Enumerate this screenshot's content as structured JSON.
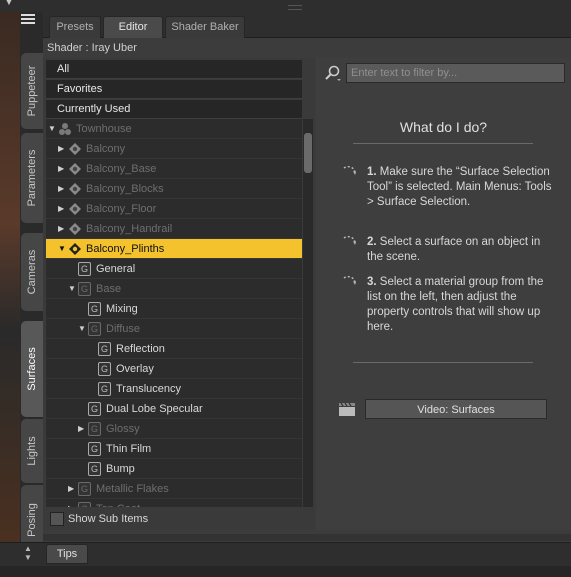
{
  "vertical_tabs": [
    "Puppeteer",
    "Parameters",
    "Cameras",
    "Surfaces",
    "Lights",
    "Posing"
  ],
  "active_vertical_tab": "Surfaces",
  "tabs": [
    "Presets",
    "Editor",
    "Shader Baker"
  ],
  "active_tab": "Editor",
  "shader_label": "Shader : Iray Uber",
  "filters": [
    "All",
    "Favorites",
    "Currently Used"
  ],
  "tree": [
    {
      "label": "Townhouse",
      "indent": 0,
      "expand": "down",
      "icon": "figure",
      "dim": true
    },
    {
      "label": "Balcony",
      "indent": 1,
      "expand": "right",
      "icon": "object",
      "dim": true
    },
    {
      "label": "Balcony_Base",
      "indent": 1,
      "expand": "right",
      "icon": "object",
      "dim": true
    },
    {
      "label": "Balcony_Blocks",
      "indent": 1,
      "expand": "right",
      "icon": "object",
      "dim": true
    },
    {
      "label": "Balcony_Floor",
      "indent": 1,
      "expand": "right",
      "icon": "object",
      "dim": true
    },
    {
      "label": "Balcony_Handrail",
      "indent": 1,
      "expand": "right",
      "icon": "object",
      "dim": true
    },
    {
      "label": "Balcony_Plinths",
      "indent": 1,
      "expand": "down",
      "icon": "object",
      "dim": false,
      "selected": true
    },
    {
      "label": "General",
      "indent": 2,
      "expand": "",
      "icon": "group",
      "dim": false
    },
    {
      "label": "Base",
      "indent": 2,
      "expand": "down",
      "icon": "group",
      "dim": true
    },
    {
      "label": "Mixing",
      "indent": 3,
      "expand": "",
      "icon": "group",
      "dim": false
    },
    {
      "label": "Diffuse",
      "indent": 3,
      "expand": "down",
      "icon": "group",
      "dim": true
    },
    {
      "label": "Reflection",
      "indent": 4,
      "expand": "",
      "icon": "group",
      "dim": false
    },
    {
      "label": "Overlay",
      "indent": 4,
      "expand": "",
      "icon": "group",
      "dim": false
    },
    {
      "label": "Translucency",
      "indent": 4,
      "expand": "",
      "icon": "group",
      "dim": false
    },
    {
      "label": "Dual Lobe Specular",
      "indent": 3,
      "expand": "",
      "icon": "group",
      "dim": false
    },
    {
      "label": "Glossy",
      "indent": 3,
      "expand": "right",
      "icon": "group",
      "dim": true
    },
    {
      "label": "Thin Film",
      "indent": 3,
      "expand": "",
      "icon": "group",
      "dim": false
    },
    {
      "label": "Bump",
      "indent": 3,
      "expand": "",
      "icon": "group",
      "dim": false
    },
    {
      "label": "Metallic Flakes",
      "indent": 2,
      "expand": "right",
      "icon": "group",
      "dim": true
    },
    {
      "label": "Top Coat",
      "indent": 2,
      "expand": "right",
      "icon": "group",
      "dim": true
    }
  ],
  "show_sub_items": "Show Sub Items",
  "search_placeholder": "Enter text to filter by...",
  "help": {
    "title": "What do I do?",
    "steps": [
      {
        "num": "1.",
        "text": "Make sure the “Surface Selection Tool” is selected. Main Menus: Tools > Surface Selection."
      },
      {
        "num": "2.",
        "text": "Select a surface on an object in the scene."
      },
      {
        "num": "3.",
        "text": "Select a material group from the list on the left, then adjust the property controls that will show up here."
      }
    ],
    "video_button": "Video: Surfaces"
  },
  "bottom_tab": "Tips",
  "colors": {
    "selected_row": "#f3c22c",
    "panel_bg": "#3a3a3a",
    "tree_bg": "#2c2c2c"
  }
}
